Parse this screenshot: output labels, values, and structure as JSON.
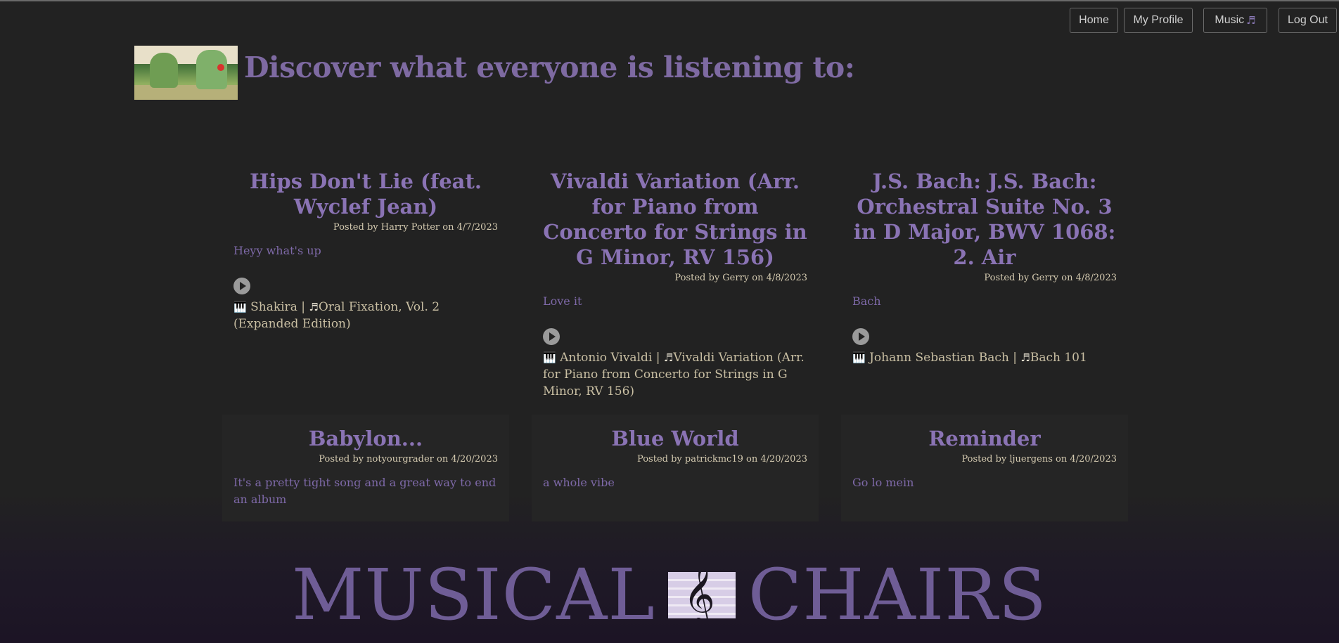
{
  "nav": {
    "home": "Home",
    "profile": "My Profile",
    "music": "Music",
    "music_icon": "♬",
    "logout": "Log Out"
  },
  "header": {
    "title": "Discover what everyone is listening to:"
  },
  "posts": [
    {
      "title": "Hips Don't Lie (feat. Wyclef Jean)",
      "meta": "Posted by Harry Potter on 4/7/2023",
      "body": "Heyy what's up",
      "artist": "Shakira",
      "album": "Oral Fixation, Vol. 2 (Expanded Edition)"
    },
    {
      "title": "Vivaldi Variation (Arr. for Piano from Concerto for Strings in G Minor, RV 156)",
      "meta": "Posted by Gerry on 4/8/2023",
      "body": "Love it",
      "artist": "Antonio Vivaldi",
      "album": "Vivaldi Variation (Arr. for Piano from Concerto for Strings in G Minor, RV 156)"
    },
    {
      "title": "J.S. Bach: J.S. Bach: Orchestral Suite No. 3 in D Major, BWV 1068: 2. Air",
      "meta": "Posted by Gerry on 4/8/2023",
      "body": "Bach",
      "artist": "Johann Sebastian Bach",
      "album": "Bach 101"
    },
    {
      "title": "Babylon...",
      "meta": "Posted by notyourgrader on 4/20/2023",
      "body": "It's a pretty tight song and a great way to end an album"
    },
    {
      "title": "Blue World",
      "meta": "Posted by patrickmc19 on 4/20/2023",
      "body": "a whole vibe"
    },
    {
      "title": "Reminder",
      "meta": "Posted by ljuergens on 4/20/2023",
      "body": "Go lo mein"
    }
  ],
  "icons": {
    "piano": "🎹",
    "note": "♬",
    "separator": "|"
  },
  "footer": {
    "word_left": "MUSICAL",
    "word_right": "CHAIRS",
    "clef": "𝄞"
  }
}
